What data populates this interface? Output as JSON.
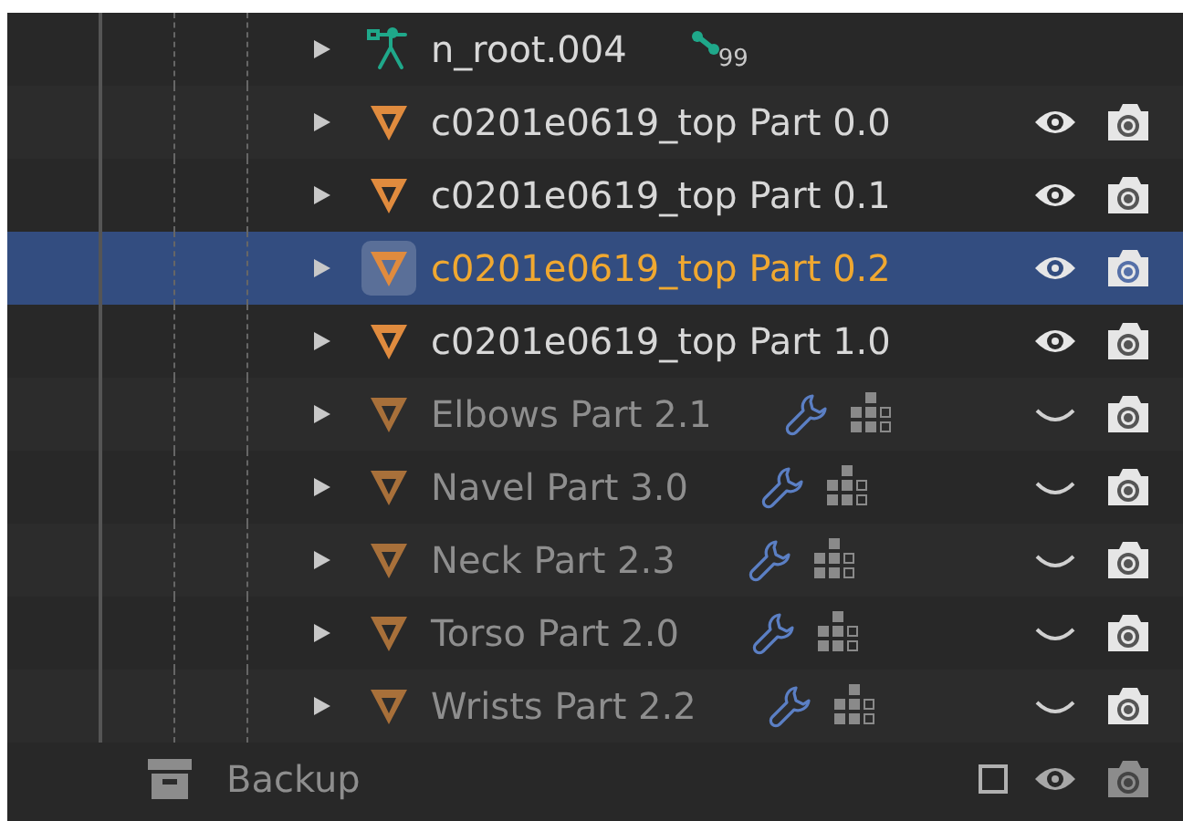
{
  "outliner": {
    "items": [
      {
        "kind": "armature",
        "name": "n_root.004",
        "selected": false,
        "badge": "99"
      },
      {
        "kind": "mesh",
        "name": "c0201e0619_top Part 0.0",
        "selected": false,
        "visible": true,
        "modifiers": false
      },
      {
        "kind": "mesh",
        "name": "c0201e0619_top Part 0.1",
        "selected": false,
        "visible": true,
        "modifiers": false
      },
      {
        "kind": "mesh",
        "name": "c0201e0619_top Part 0.2",
        "selected": true,
        "visible": true,
        "modifiers": false
      },
      {
        "kind": "mesh",
        "name": "c0201e0619_top Part 1.0",
        "selected": false,
        "visible": true,
        "modifiers": false
      },
      {
        "kind": "mesh",
        "name": "Elbows Part 2.1",
        "selected": false,
        "visible": false,
        "modifiers": true
      },
      {
        "kind": "mesh",
        "name": "Navel Part 3.0",
        "selected": false,
        "visible": false,
        "modifiers": true
      },
      {
        "kind": "mesh",
        "name": "Neck Part 2.3",
        "selected": false,
        "visible": false,
        "modifiers": true
      },
      {
        "kind": "mesh",
        "name": "Torso Part 2.0",
        "selected": false,
        "visible": false,
        "modifiers": true
      },
      {
        "kind": "mesh",
        "name": "Wrists Part 2.2",
        "selected": false,
        "visible": false,
        "modifiers": true
      }
    ],
    "collection": {
      "name": "Backup",
      "checked": false
    }
  }
}
